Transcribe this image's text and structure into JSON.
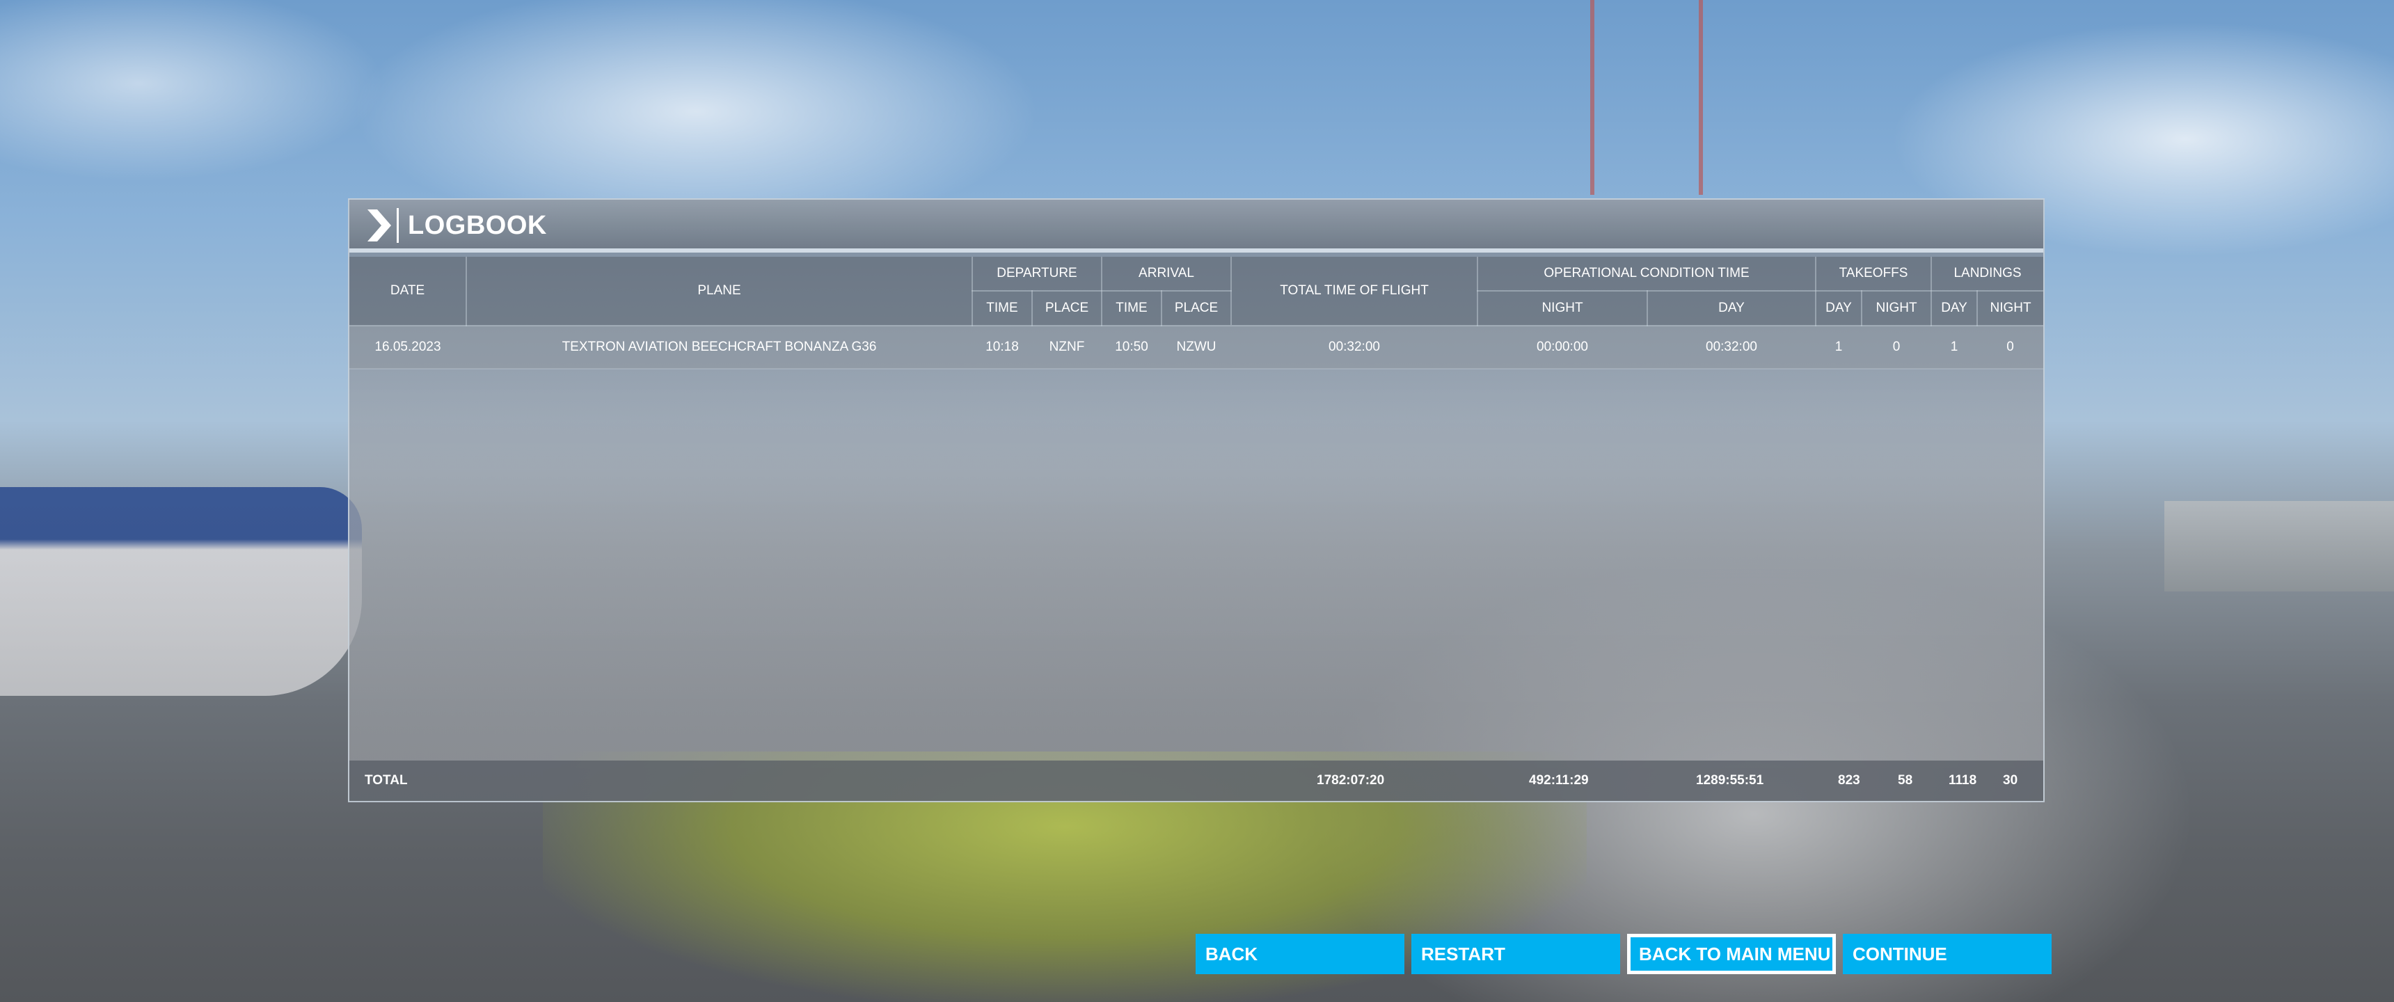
{
  "panel": {
    "title": "LOGBOOK"
  },
  "table": {
    "headers": {
      "date": "DATE",
      "plane": "PLANE",
      "departure": "DEPARTURE",
      "arrival": "ARRIVAL",
      "total_time": "TOTAL TIME OF FLIGHT",
      "operational": "OPERATIONAL CONDITION TIME",
      "takeoffs": "TAKEOFFS",
      "landings": "LANDINGS",
      "dep_time": "TIME",
      "dep_place": "PLACE",
      "arr_time": "TIME",
      "arr_place": "PLACE",
      "op_night": "NIGHT",
      "op_day": "DAY",
      "to_day": "DAY",
      "to_night": "NIGHT",
      "ld_day": "DAY",
      "ld_night": "NIGHT"
    },
    "rows": [
      {
        "date": "16.05.2023",
        "plane": "TEXTRON AVIATION BEECHCRAFT BONANZA G36",
        "dep_time": "10:18",
        "dep_place": "NZNF",
        "arr_time": "10:50",
        "arr_place": "NZWU",
        "total_time": "00:32:00",
        "op_night": "00:00:00",
        "op_day": "00:32:00",
        "to_day": "1",
        "to_night": "0",
        "ld_day": "1",
        "ld_night": "0"
      }
    ],
    "total": {
      "label": "TOTAL",
      "total_time": "1782:07:20",
      "op_night": "492:11:29",
      "op_day": "1289:55:51",
      "to_day": "823",
      "to_night": "58",
      "ld_day": "1118",
      "ld_night": "30"
    }
  },
  "buttons": {
    "back": "BACK",
    "restart": "RESTART",
    "main_menu": "BACK TO MAIN MENU",
    "continue": "CONTINUE"
  },
  "colors": {
    "button_accent": "#00b1f0"
  },
  "icons": {
    "header": "chevron-right-icon"
  }
}
